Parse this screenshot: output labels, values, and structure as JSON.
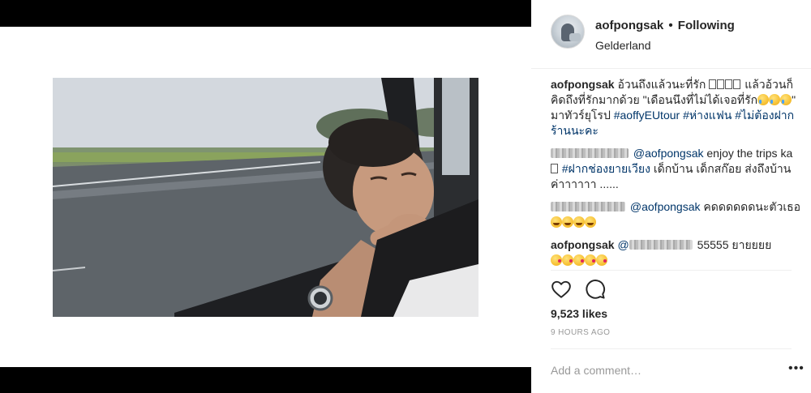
{
  "post": {
    "username": "aofpongsak",
    "separator": "•",
    "follow_status": "Following",
    "location": "Gelderland",
    "caption": {
      "username": "aofpongsak",
      "text_1": "อ้วนถึงแล้วนะที่รัก",
      "text_2": "แล้วอ้วนก็คิดถึงที่รักมากด้วย \"เดือนนึงที่ไม่ได้เจอที่รัก",
      "text_3": "\" มาทัวร์ยุโรป",
      "hashtag_1": "#aoffyEUtour",
      "hashtag_2": "#ห่างแฟน",
      "hashtag_3": "#ไม่ต้องฝากร้านนะคะ"
    },
    "comments": [
      {
        "mention": "@aofpongsak",
        "text_1": "enjoy the trips ka",
        "hashtag": "#ฝากช่องยายเวียง",
        "text_2": "เด็กบ้าน เด็กสก๊อย ส่งถึงบ้านค่าาาาาา ......"
      },
      {
        "mention": "@aofpongsak",
        "text": "คดดดดดดนะตัวเธอ"
      },
      {
        "username": "aofpongsak",
        "text": "55555 ยายยยย"
      }
    ],
    "likes": "9,523 likes",
    "time": "9 HOURS AGO",
    "add_comment_placeholder": "Add a comment…",
    "more_label": "•••",
    "icons": {
      "like": "heart-icon",
      "comment": "comment-bubble-icon"
    }
  }
}
